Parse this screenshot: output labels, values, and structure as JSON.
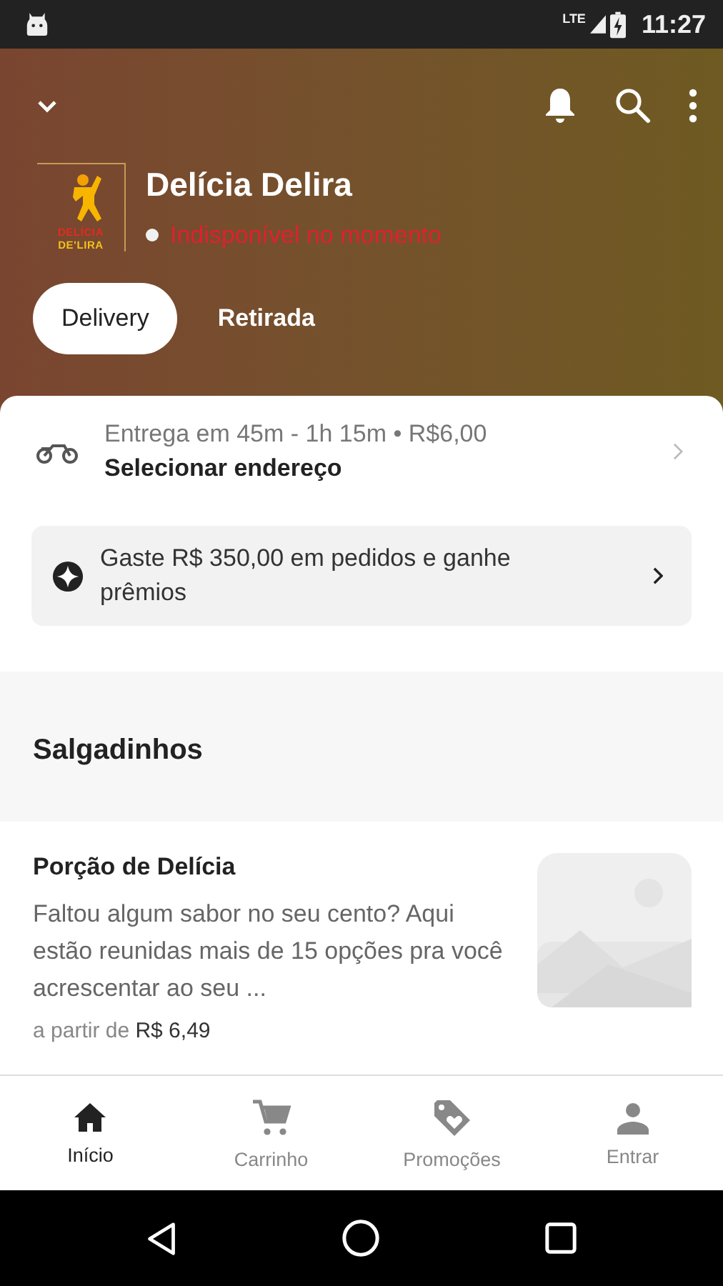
{
  "status_bar": {
    "time": "11:27",
    "network": "LTE"
  },
  "header": {
    "store_name": "Delícia Delira",
    "logo_lines": [
      "DELÍCIA",
      "DE'LIRA"
    ],
    "status": "Indisponível no momento",
    "open": false
  },
  "mode_tabs": [
    {
      "label": "Delivery",
      "selected": true
    },
    {
      "label": "Retirada",
      "selected": false
    }
  ],
  "delivery": {
    "info": "Entrega em 45m - 1h 15m • R$6,00",
    "action": "Selecionar endereço"
  },
  "promo": {
    "text": "Gaste R$ 350,00 em pedidos e ganhe prêmios"
  },
  "section": {
    "title": "Salgadinhos"
  },
  "products": [
    {
      "name": "Porção de Delícia",
      "description": "Faltou algum sabor no seu cento? Aqui estão reunidas mais de 15 opções pra você acrescentar ao seu ...",
      "price_prefix": "a partir de",
      "price": "R$ 6,49",
      "kind": "picture"
    }
  ],
  "bottom_nav": [
    {
      "label": "Início",
      "kind": "home",
      "selected": true
    },
    {
      "label": "Carrinho",
      "kind": "cart",
      "selected": false
    },
    {
      "label": "Promoções",
      "kind": "promotions",
      "selected": false
    },
    {
      "label": "Entrar",
      "kind": "account",
      "selected": false
    }
  ]
}
